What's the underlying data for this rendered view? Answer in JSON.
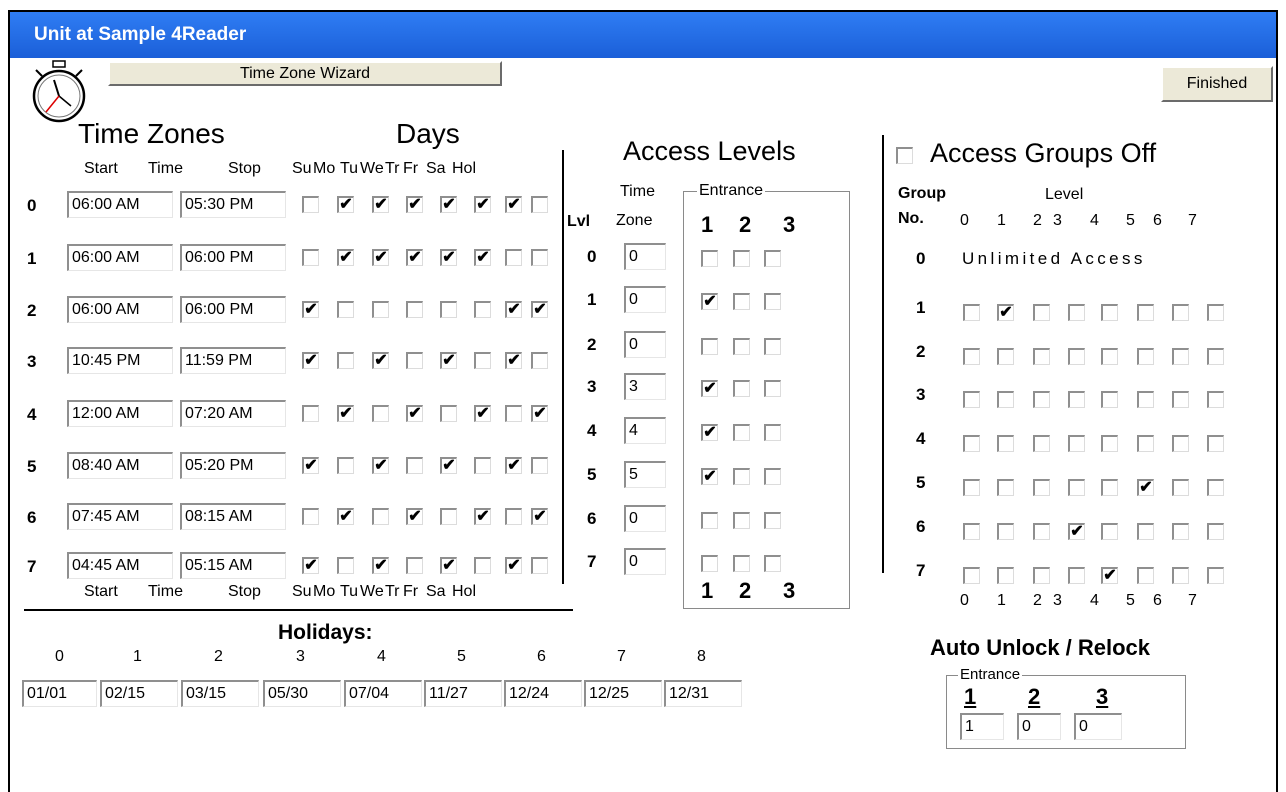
{
  "window": {
    "title": "Unit at Sample 4Reader"
  },
  "toolbar": {
    "wizard_label": "Time Zone Wizard",
    "finished_label": "Finished"
  },
  "time_zones": {
    "title": "Time Zones",
    "days_title": "Days",
    "col_start": "Start",
    "col_time": "Time",
    "col_stop": "Stop",
    "day_labels": [
      "Su",
      "Mo",
      "Tu",
      "We",
      "Tr",
      "Fr",
      "Sa",
      "Hol"
    ],
    "rows": [
      {
        "num": "0",
        "start": "06:00 AM",
        "stop": "05:30 PM",
        "days": [
          false,
          true,
          true,
          true,
          true,
          true,
          true,
          false
        ]
      },
      {
        "num": "1",
        "start": "06:00 AM",
        "stop": "06:00 PM",
        "days": [
          false,
          true,
          true,
          true,
          true,
          true,
          false,
          false
        ]
      },
      {
        "num": "2",
        "start": "06:00 AM",
        "stop": "06:00 PM",
        "days": [
          true,
          false,
          false,
          false,
          false,
          false,
          true,
          true
        ]
      },
      {
        "num": "3",
        "start": "10:45 PM",
        "stop": "11:59 PM",
        "days": [
          true,
          false,
          true,
          false,
          true,
          false,
          true,
          false
        ]
      },
      {
        "num": "4",
        "start": "12:00 AM",
        "stop": "07:20 AM",
        "days": [
          false,
          true,
          false,
          true,
          false,
          true,
          false,
          true
        ]
      },
      {
        "num": "5",
        "start": "08:40 AM",
        "stop": "05:20 PM",
        "days": [
          true,
          false,
          true,
          false,
          true,
          false,
          true,
          false
        ]
      },
      {
        "num": "6",
        "start": "07:45 AM",
        "stop": "08:15 AM",
        "days": [
          false,
          true,
          false,
          true,
          false,
          true,
          false,
          true
        ]
      },
      {
        "num": "7",
        "start": "04:45 AM",
        "stop": "05:15 AM",
        "days": [
          true,
          false,
          true,
          false,
          true,
          false,
          true,
          false
        ]
      }
    ]
  },
  "holidays": {
    "title": "Holidays:",
    "indices": [
      "0",
      "1",
      "2",
      "3",
      "4",
      "5",
      "6",
      "7",
      "8"
    ],
    "dates": [
      "01/01",
      "02/15",
      "03/15",
      "05/30",
      "07/04",
      "11/27",
      "12/24",
      "12/25",
      "12/31"
    ]
  },
  "access_levels": {
    "title": "Access Levels",
    "time_label": "Time",
    "zone_label": "Zone",
    "lvl_label": "Lvl",
    "entrance_label": "Entrance",
    "entrance_nums": [
      "1",
      "2",
      "3"
    ],
    "rows": [
      {
        "num": "0",
        "zone": "0",
        "ent": [
          false,
          false,
          false
        ]
      },
      {
        "num": "1",
        "zone": "0",
        "ent": [
          true,
          false,
          false
        ]
      },
      {
        "num": "2",
        "zone": "0",
        "ent": [
          false,
          false,
          false
        ]
      },
      {
        "num": "3",
        "zone": "3",
        "ent": [
          true,
          false,
          false
        ]
      },
      {
        "num": "4",
        "zone": "4",
        "ent": [
          true,
          false,
          false
        ]
      },
      {
        "num": "5",
        "zone": "5",
        "ent": [
          true,
          false,
          false
        ]
      },
      {
        "num": "6",
        "zone": "0",
        "ent": [
          false,
          false,
          false
        ]
      },
      {
        "num": "7",
        "zone": "0",
        "ent": [
          false,
          false,
          false
        ]
      }
    ]
  },
  "access_groups": {
    "off_label": "Access Groups Off",
    "off_checked": false,
    "group_label": "Group",
    "no_label": "No.",
    "level_label": "Level",
    "level_nums": [
      "0",
      "1",
      "2",
      "3",
      "4",
      "5",
      "6",
      "7"
    ],
    "unlimited_label": "Unlimited Access",
    "row0_num": "0",
    "rows": [
      {
        "num": "1",
        "levels": [
          false,
          true,
          false,
          false,
          false,
          false,
          false,
          false
        ]
      },
      {
        "num": "2",
        "levels": [
          false,
          false,
          false,
          false,
          false,
          false,
          false,
          false
        ]
      },
      {
        "num": "3",
        "levels": [
          false,
          false,
          false,
          false,
          false,
          false,
          false,
          false
        ]
      },
      {
        "num": "4",
        "levels": [
          false,
          false,
          false,
          false,
          false,
          false,
          false,
          false
        ]
      },
      {
        "num": "5",
        "levels": [
          false,
          false,
          false,
          false,
          false,
          true,
          false,
          false
        ]
      },
      {
        "num": "6",
        "levels": [
          false,
          false,
          false,
          true,
          false,
          false,
          false,
          false
        ]
      },
      {
        "num": "7",
        "levels": [
          false,
          false,
          false,
          false,
          true,
          false,
          false,
          false
        ]
      }
    ]
  },
  "auto_unlock": {
    "title": "Auto Unlock / Relock",
    "entrance_label": "Entrance",
    "entrance_nums": [
      "1",
      "2",
      "3"
    ],
    "values": [
      "1",
      "0",
      "0"
    ]
  }
}
